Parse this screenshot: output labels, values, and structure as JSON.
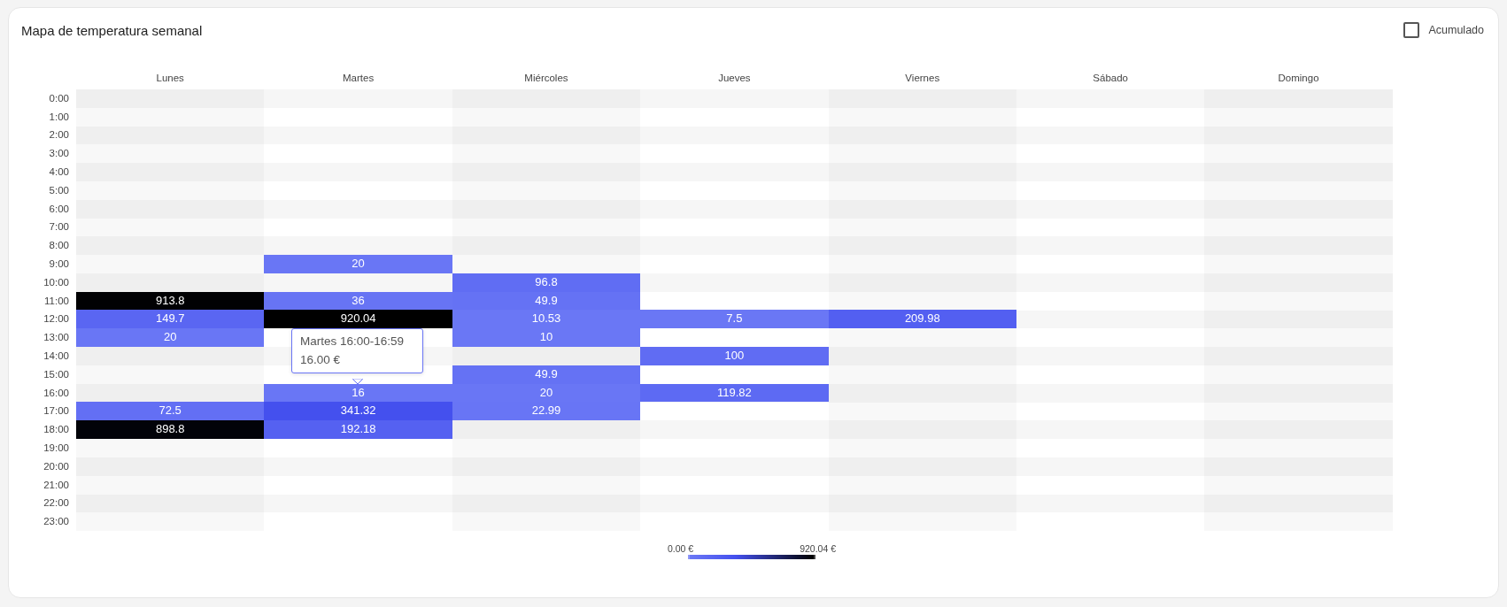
{
  "title": "Mapa de temperatura semanal",
  "accumulated": {
    "label": "Acumulado",
    "checked": false
  },
  "days": [
    "Lunes",
    "Martes",
    "Miércoles",
    "Jueves",
    "Viernes",
    "Sábado",
    "Domingo"
  ],
  "rows": [
    {
      "hour": "0:00"
    },
    {
      "hour": "1:00"
    },
    {
      "hour": "2:00"
    },
    {
      "hour": "3:00"
    },
    {
      "hour": "4:00"
    },
    {
      "hour": "5:00"
    },
    {
      "hour": "6:00"
    },
    {
      "hour": "7:00"
    },
    {
      "hour": "8:00"
    },
    {
      "hour": "9:00",
      "day_2": "20"
    },
    {
      "hour": "10:00",
      "day_3": "96.8"
    },
    {
      "hour": "11:00",
      "day_1": "913.8",
      "day_2": "36",
      "day_3": "49.9"
    },
    {
      "hour": "12:00",
      "day_1": "149.7",
      "day_2": "920.04",
      "day_3": "10.53",
      "day_4": "7.5",
      "day_5": "209.98"
    },
    {
      "hour": "13:00",
      "day_1": "20",
      "day_3": "10"
    },
    {
      "hour": "14:00",
      "day_4": "100"
    },
    {
      "hour": "15:00",
      "day_3": "49.9"
    },
    {
      "hour": "16:00",
      "day_2": "16",
      "day_3": "20",
      "day_4": "119.82"
    },
    {
      "hour": "17:00",
      "day_1": "72.5",
      "day_2": "341.32",
      "day_3": "22.99"
    },
    {
      "hour": "18:00",
      "day_1": "898.8",
      "day_2": "192.18"
    },
    {
      "hour": "19:00"
    },
    {
      "hour": "20:00"
    },
    {
      "hour": "21:00"
    },
    {
      "hour": "22:00"
    },
    {
      "hour": "23:00"
    }
  ],
  "tooltip": {
    "title": "Martes 16:00-16:59",
    "value": "16.00 €"
  },
  "legend": {
    "min": "0.00 €",
    "max": "920.04 €"
  }
}
